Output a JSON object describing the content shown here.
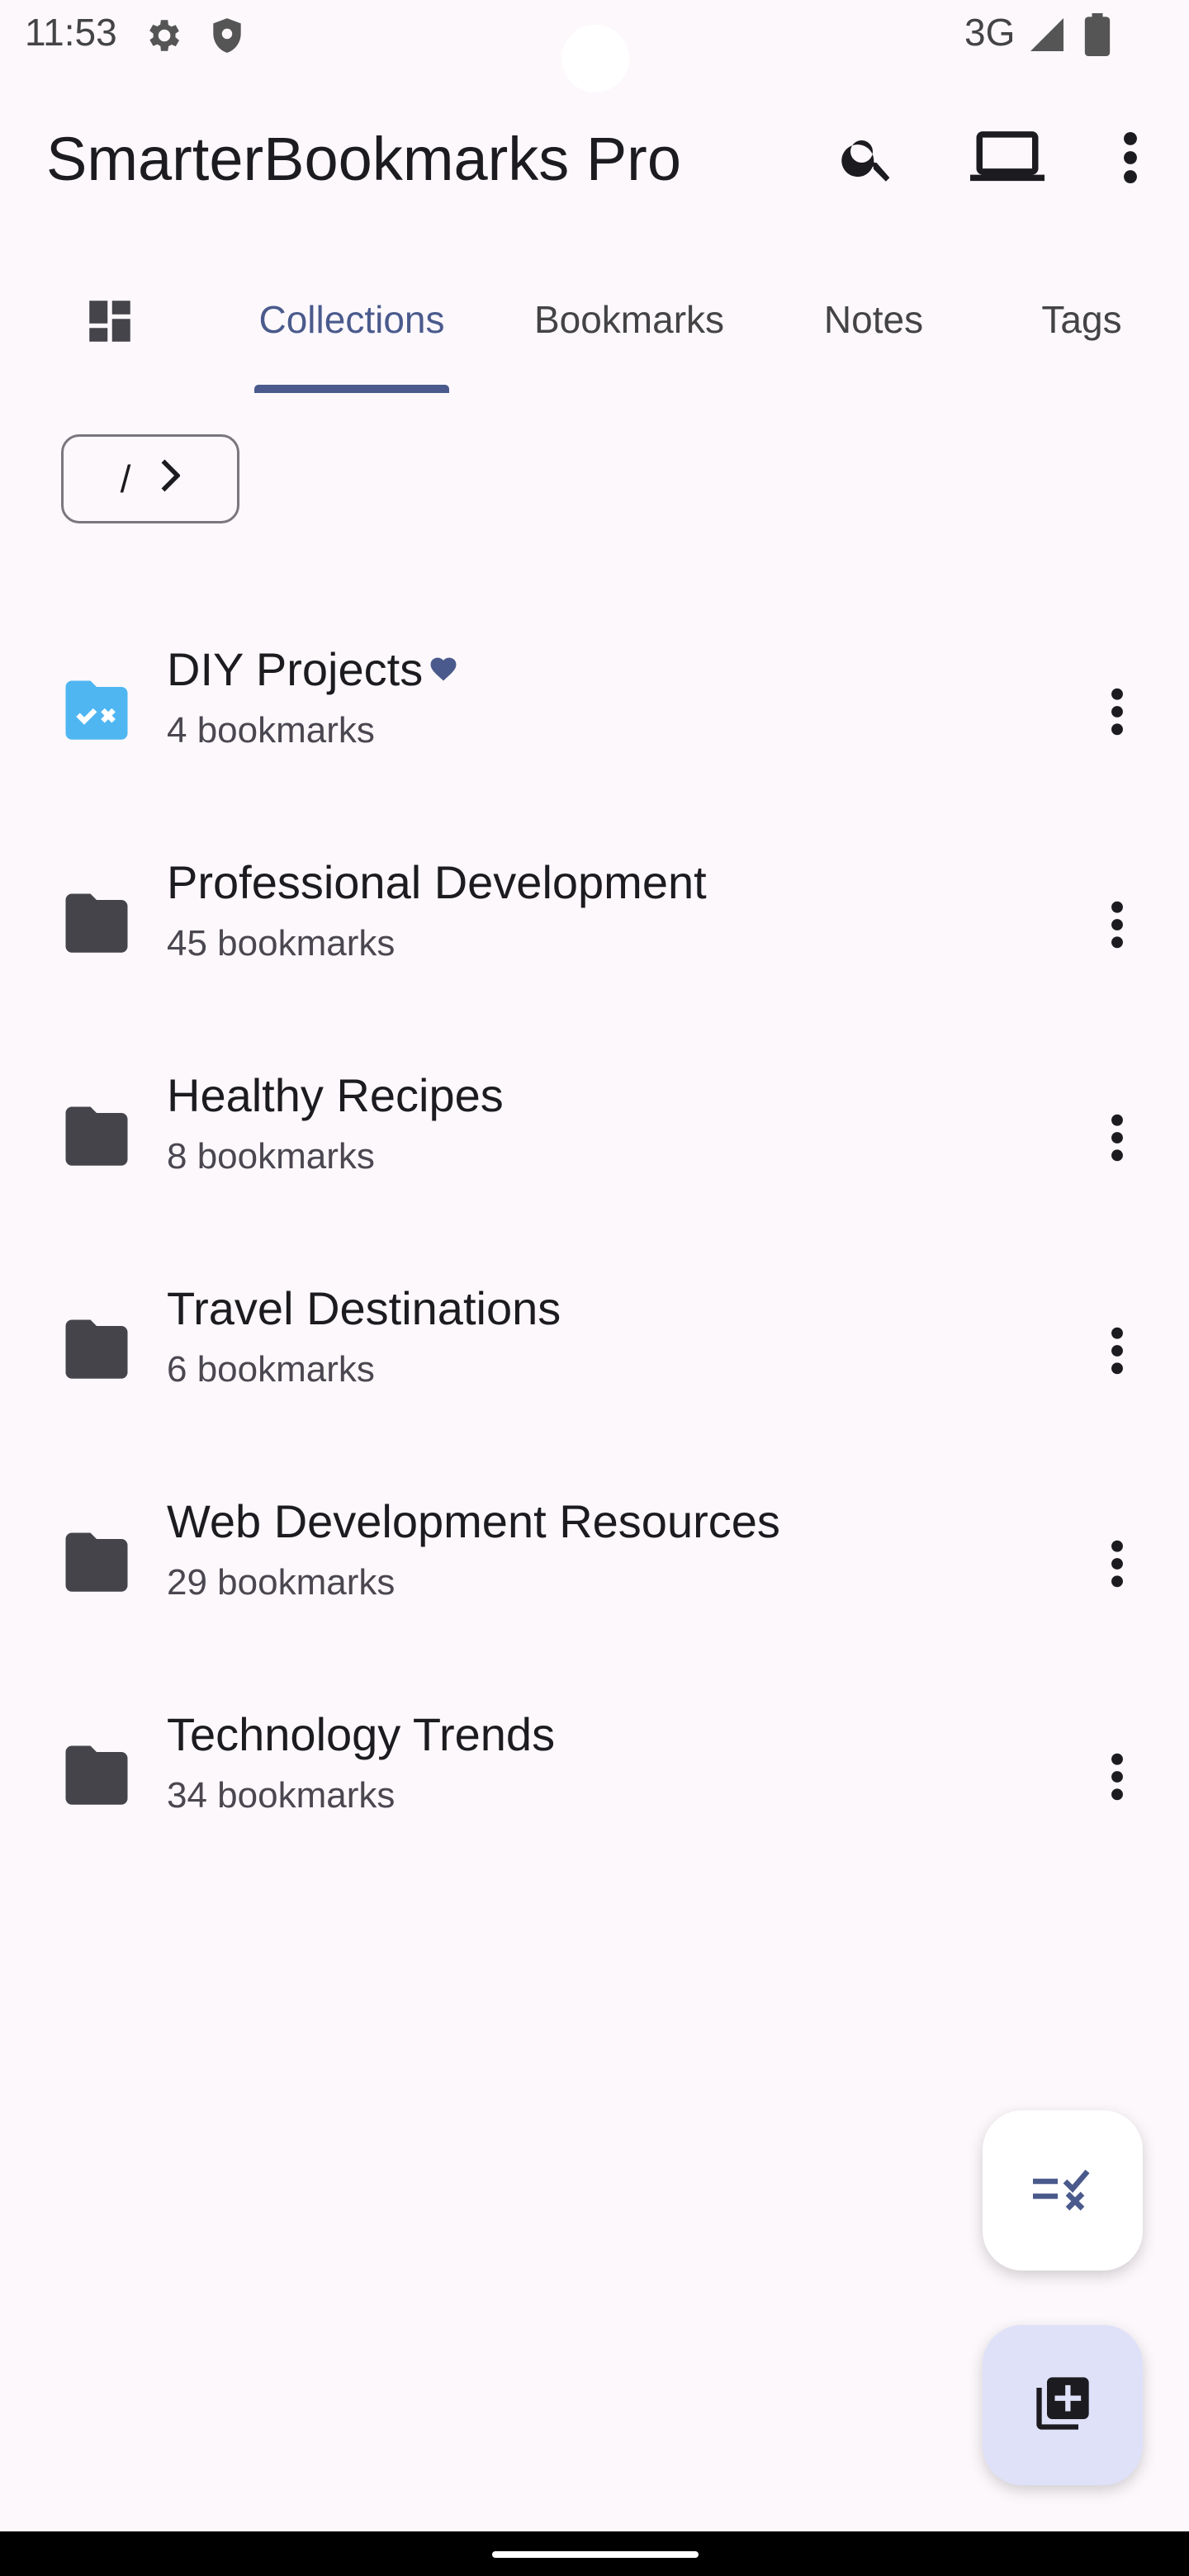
{
  "status_bar": {
    "time": "11:53",
    "network": "3G",
    "icons": [
      "settings-icon",
      "shield-icon",
      "signal-icon",
      "battery-icon"
    ]
  },
  "app_bar": {
    "title": "SmarterBookmarks Pro",
    "actions": [
      "search-icon",
      "laptop-icon",
      "more-vert-icon"
    ]
  },
  "tabs": [
    {
      "label": "Collections",
      "selected": true
    },
    {
      "label": "Bookmarks",
      "selected": false
    },
    {
      "label": "Notes",
      "selected": false
    },
    {
      "label": "Tags",
      "selected": false
    }
  ],
  "breadcrumb": {
    "path": "/",
    "icon": "chevron-right-icon"
  },
  "collections": [
    {
      "title": "DIY Projects",
      "count": "4 bookmarks",
      "favorite": true,
      "icon": "folder-shared-icon"
    },
    {
      "title": "Professional Development",
      "count": "45 bookmarks",
      "favorite": false,
      "icon": "folder-icon"
    },
    {
      "title": "Healthy Recipes",
      "count": "8 bookmarks",
      "favorite": false,
      "icon": "folder-icon"
    },
    {
      "title": "Travel Destinations",
      "count": "6 bookmarks",
      "favorite": false,
      "icon": "folder-icon"
    },
    {
      "title": "Web Development Resources",
      "count": "29 bookmarks",
      "favorite": false,
      "icon": "folder-icon"
    },
    {
      "title": "Technology Trends",
      "count": "34 bookmarks",
      "favorite": false,
      "icon": "folder-icon"
    }
  ],
  "fabs": [
    {
      "name": "select-mode-button",
      "icon": "checklist-icon"
    },
    {
      "name": "add-collection-button",
      "icon": "library-add-icon"
    }
  ],
  "colors": {
    "accent": "#4a5a8c",
    "background": "#fcf8fc",
    "folder": "#45444b",
    "folder_special": "#4fb6f2",
    "fab_add_bg": "#dfe1f9"
  }
}
